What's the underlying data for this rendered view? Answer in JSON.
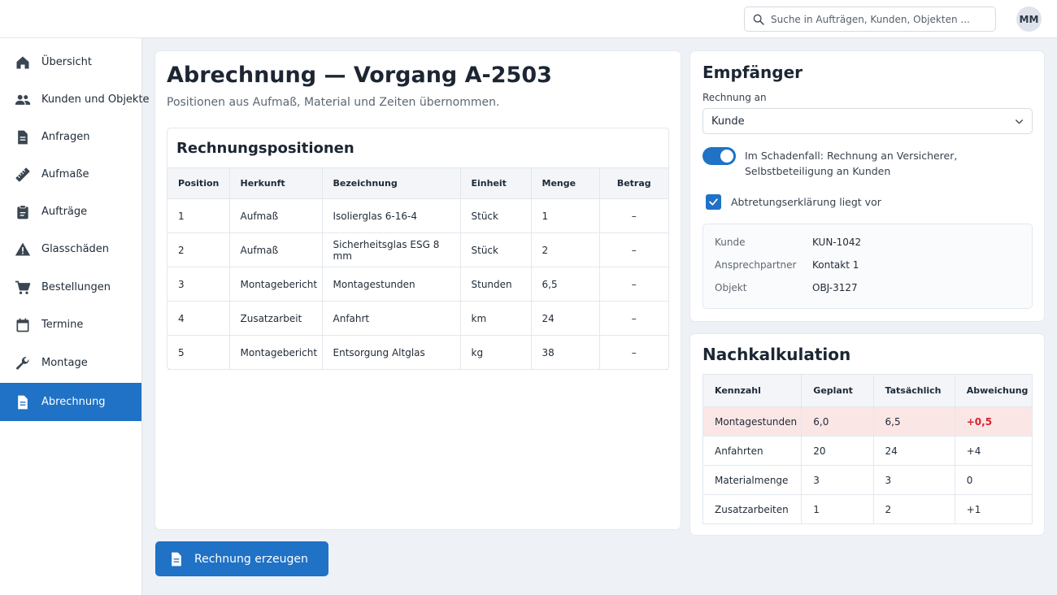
{
  "header": {
    "search_placeholder": "Suche in Aufträgen, Kunden, Objekten ...",
    "avatar_initials": "MM"
  },
  "sidebar": {
    "items": [
      {
        "label": "Übersicht",
        "icon": "home-icon"
      },
      {
        "label": "Kunden und Objekte",
        "icon": "people-icon"
      },
      {
        "label": "Anfragen",
        "icon": "document-icon"
      },
      {
        "label": "Aufmaße",
        "icon": "ruler-icon"
      },
      {
        "label": "Aufträge",
        "icon": "clipboard-icon"
      },
      {
        "label": "Glasschäden",
        "icon": "warning-icon"
      },
      {
        "label": "Bestellungen",
        "icon": "cart-icon"
      },
      {
        "label": "Termine",
        "icon": "calendar-icon"
      },
      {
        "label": "Montage",
        "icon": "wrench-icon"
      },
      {
        "label": "Abrechnung",
        "icon": "document-icon",
        "active": true
      }
    ]
  },
  "main": {
    "title": "Abrechnung — Vorgang A-2503",
    "subtitle": "Positionen aus Aufmaß, Material und Zeiten übernommen.",
    "positions": {
      "title": "Rechnungspositionen",
      "columns": [
        "Position",
        "Herkunft",
        "Bezeichnung",
        "Einheit",
        "Menge",
        "Betrag"
      ],
      "rows": [
        [
          "1",
          "Aufmaß",
          "Isolierglas 6-16-4",
          "Stück",
          "1",
          "–"
        ],
        [
          "2",
          "Aufmaß",
          "Sicherheitsglas ESG 8 mm",
          "Stück",
          "2",
          "–"
        ],
        [
          "3",
          "Montagebericht",
          "Montagestunden",
          "Stunden",
          "6,5",
          "–"
        ],
        [
          "4",
          "Zusatzarbeit",
          "Anfahrt",
          "km",
          "24",
          "–"
        ],
        [
          "5",
          "Montagebericht",
          "Entsorgung Altglas",
          "kg",
          "38",
          "–"
        ]
      ]
    },
    "create_button": "Rechnung erzeugen"
  },
  "recipient": {
    "title": "Empfänger",
    "invoice_to_label": "Rechnung an",
    "invoice_to_value": "Kunde",
    "toggle_label": "Im Schadenfall: Rechnung an Versicherer, Selbstbeteiligung an Kunden",
    "toggle_on": true,
    "checkbox_label": "Abtretungserklärung liegt vor",
    "checkbox_checked": true,
    "info": [
      {
        "key": "Kunde",
        "value": "KUN-1042"
      },
      {
        "key": "Ansprechpartner",
        "value": "Kontakt 1"
      },
      {
        "key": "Objekt",
        "value": "OBJ-3127"
      }
    ]
  },
  "postcalc": {
    "title": "Nachkalkulation",
    "columns": [
      "Kennzahl",
      "Geplant",
      "Tatsächlich",
      "Abweichung"
    ],
    "rows": [
      [
        "Montagestunden",
        "6,0",
        "6,5",
        "+0,5"
      ],
      [
        "Anfahrten",
        "20",
        "24",
        "+4"
      ],
      [
        "Materialmenge",
        "3",
        "3",
        "0"
      ],
      [
        "Zusatzarbeiten",
        "1",
        "2",
        "+1"
      ]
    ],
    "highlight_row": 0
  },
  "colors": {
    "accent": "#1f72c6",
    "alert_row_bg": "#fbe6e6",
    "alert_text": "#d8232a"
  }
}
